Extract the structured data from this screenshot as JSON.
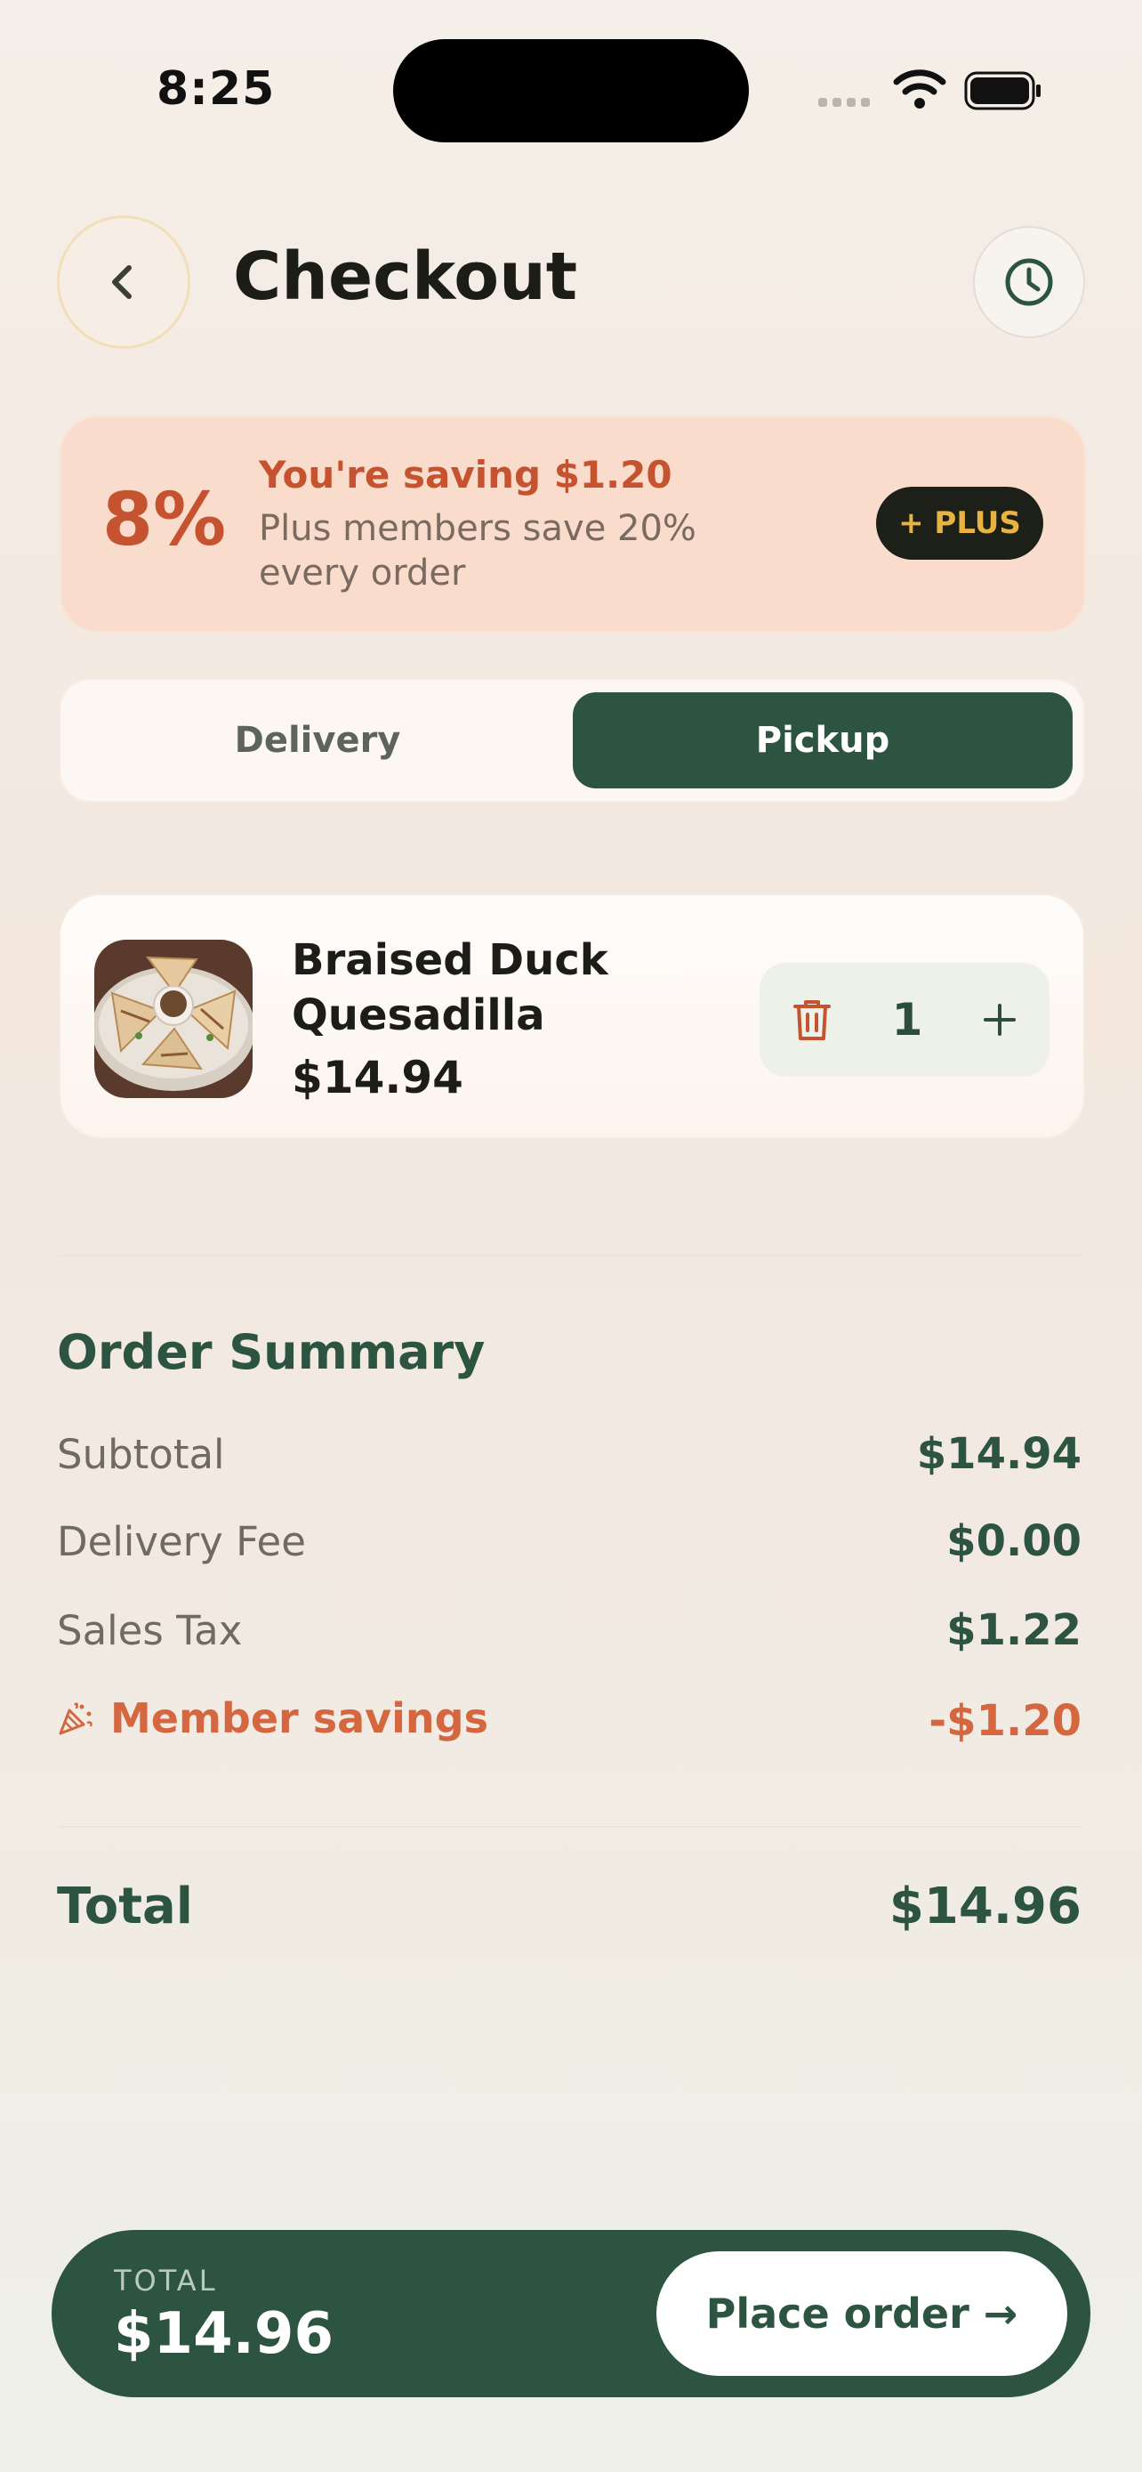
{
  "status_bar": {
    "time": "8:25"
  },
  "header": {
    "title": "Checkout",
    "back_icon": "chevron-left-icon",
    "history_icon": "clock-icon"
  },
  "promo": {
    "percent": "8%",
    "title": "You're saving $1.20",
    "subtitle": "Plus members save 20% every order",
    "plus_label": "+ PLUS"
  },
  "fulfillment": {
    "options": [
      "Delivery",
      "Pickup"
    ],
    "selected": "Pickup"
  },
  "cart": {
    "items": [
      {
        "name": "Braised Duck Quesadilla",
        "price": "$14.94",
        "quantity": "1"
      }
    ]
  },
  "summary": {
    "title": "Order Summary",
    "rows": [
      {
        "label": "Subtotal",
        "value": "$14.94"
      },
      {
        "label": "Delivery Fee",
        "value": "$0.00"
      },
      {
        "label": "Sales Tax",
        "value": "$1.22"
      }
    ],
    "savings": {
      "label": "Member savings",
      "value": "-$1.20",
      "icon": "party-popper-icon"
    },
    "total_label": "Total",
    "total_value": "$14.96"
  },
  "checkout_bar": {
    "label": "TOTAL",
    "total": "$14.96",
    "button_label": "Place order →"
  },
  "colors": {
    "primary_green": "#2c5440",
    "accent_orange": "#c6532f",
    "promo_bg": "#f9dccb",
    "plus_gold": "#e8b340"
  }
}
